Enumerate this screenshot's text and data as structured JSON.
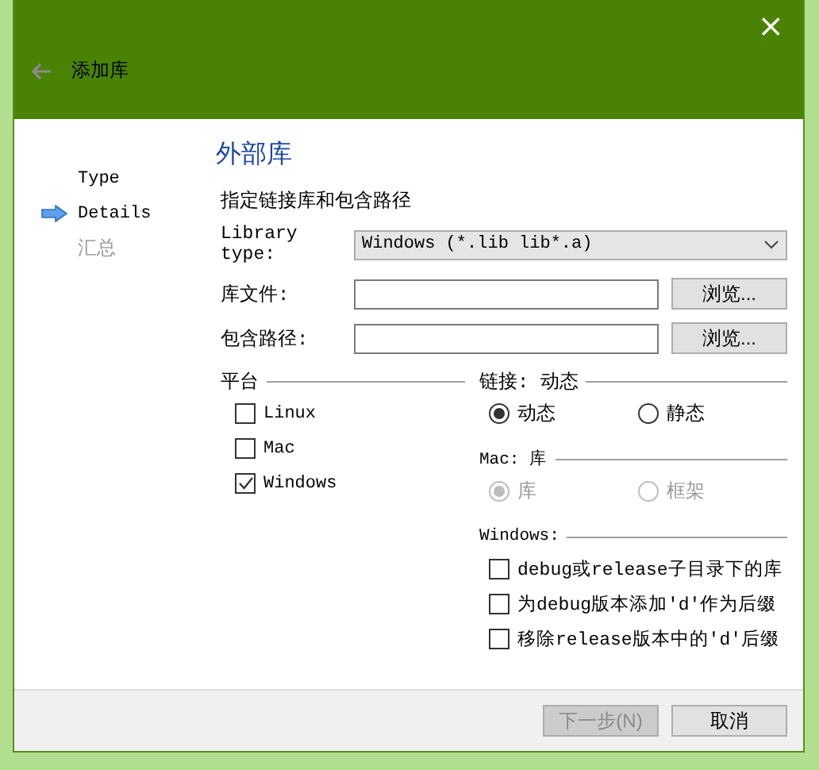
{
  "window": {
    "title": "添加库",
    "close": "×"
  },
  "steps": [
    {
      "label": "Type",
      "selected": false,
      "pending": false
    },
    {
      "label": "Details",
      "selected": true,
      "pending": false
    },
    {
      "label": "汇总",
      "selected": false,
      "pending": true
    }
  ],
  "page": {
    "heading": "外部库",
    "subtitle": "指定链接库和包含路径"
  },
  "library_type": {
    "label": "Library type:",
    "value": "Windows (*.lib lib*.a)"
  },
  "fields": [
    {
      "label": "库文件:",
      "button": "浏览..."
    },
    {
      "label": "包含路径:",
      "button": "浏览..."
    }
  ],
  "platform": {
    "title": "平台",
    "options": [
      {
        "label": "Linux",
        "checked": false
      },
      {
        "label": "Mac",
        "checked": false
      },
      {
        "label": "Windows",
        "checked": true
      }
    ]
  },
  "linking": {
    "title": "链接: 动态",
    "options": [
      {
        "label": "动态",
        "selected": true,
        "disabled": false
      },
      {
        "label": "静态",
        "selected": false,
        "disabled": false
      }
    ]
  },
  "mac": {
    "title": "Mac: 库",
    "options": [
      {
        "label": "库",
        "selected": true,
        "disabled": true
      },
      {
        "label": "框架",
        "selected": false,
        "disabled": true
      }
    ]
  },
  "windows": {
    "title": "Windows:",
    "options": [
      {
        "label": "debug或release子目录下的库",
        "checked": false
      },
      {
        "label": "为debug版本添加'd'作为后缀",
        "checked": false
      },
      {
        "label": "移除release版本中的'd'后缀",
        "checked": false
      }
    ]
  },
  "buttons": [
    {
      "label": "下一步(N)",
      "disabled": true
    },
    {
      "label": "取消",
      "disabled": false
    }
  ]
}
